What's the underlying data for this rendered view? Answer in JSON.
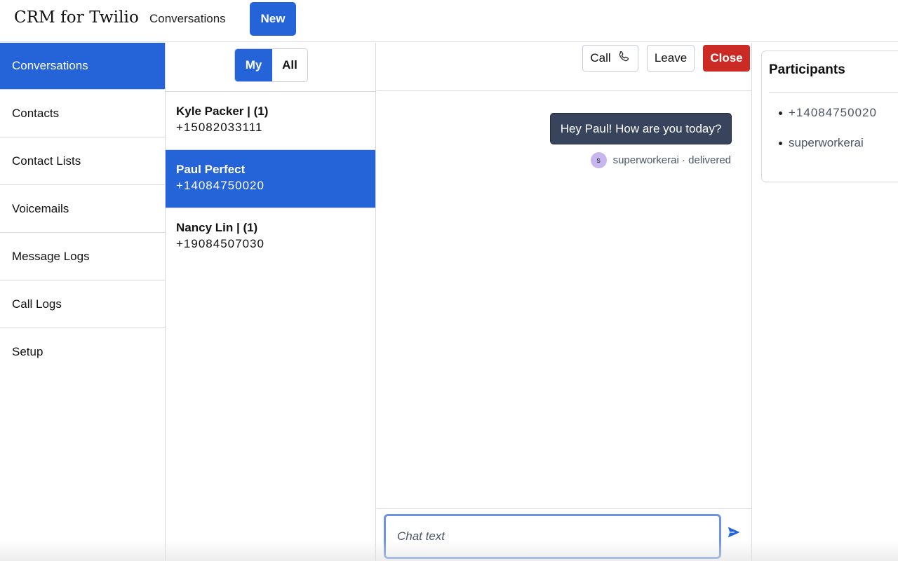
{
  "header": {
    "brand": "CRM for Twilio",
    "nav_link": "Conversations",
    "new_label": "New"
  },
  "sidebar": {
    "items": [
      {
        "label": "Conversations",
        "active": true
      },
      {
        "label": "Contacts"
      },
      {
        "label": "Contact Lists"
      },
      {
        "label": "Voicemails"
      },
      {
        "label": "Message Logs"
      },
      {
        "label": "Call Logs"
      },
      {
        "label": "Setup"
      }
    ]
  },
  "filter": {
    "my_label": "My",
    "all_label": "All",
    "selected": "My"
  },
  "conversations": [
    {
      "name": "Kyle Packer | (1)",
      "phone": "+15082033111"
    },
    {
      "name": "Paul Perfect",
      "phone": "+14084750020",
      "active": true
    },
    {
      "name": "Nancy Lin | (1)",
      "phone": "+19084507030"
    }
  ],
  "chat": {
    "call_label": "Call",
    "leave_label": "Leave",
    "close_label": "Close",
    "messages": [
      {
        "text": "Hey Paul! How are you today?",
        "author": "superworkerai",
        "avatar_initial": "s",
        "status_line": "superworkerai · delivered"
      }
    ],
    "input_placeholder": "Chat text"
  },
  "participants": {
    "title": "Participants",
    "items": [
      "+14084750020",
      "superworkerai"
    ]
  },
  "colors": {
    "primary": "#2563d9",
    "danger": "#cc2a24",
    "bubble": "#37445c",
    "avatar": "#c8b6ee"
  },
  "icons": {
    "call": "phone-icon",
    "send": "send-icon"
  }
}
